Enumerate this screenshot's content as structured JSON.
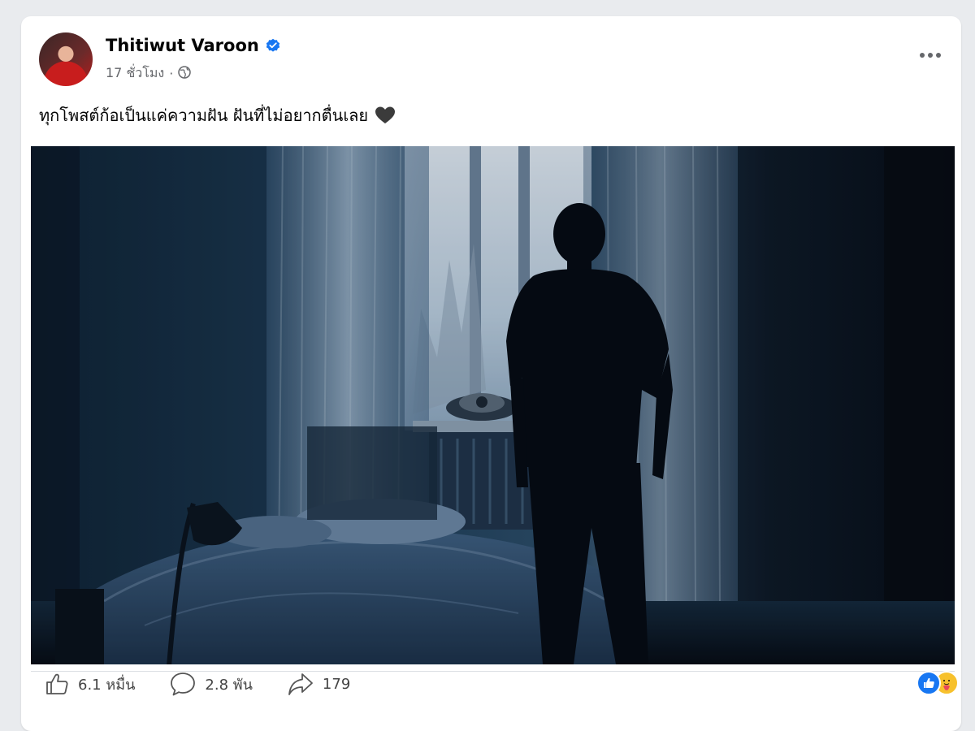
{
  "post": {
    "author_name": "Thitiwut Varoon",
    "time": "17 ชั่วโมง",
    "separator": "·",
    "text": "ทุกโพสต์ก้อเป็นแค่ความฝัน ฝันที่ไม่อยากตื่นเลย",
    "text_emoji": "black-heart",
    "image": "silhouette-man-at-window-dark-bedroom"
  },
  "stats": {
    "likes": "6.1 หมื่น",
    "comments": "2.8 พัน",
    "shares": "179"
  },
  "icons": {
    "verified": "verified-badge-icon",
    "privacy": "globe-icon",
    "more": "more-options-icon",
    "like": "thumbs-up-icon",
    "comment": "comment-bubble-icon",
    "share": "share-arrow-icon",
    "reactions": [
      "like-reaction-icon",
      "care-reaction-icon"
    ]
  },
  "colors": {
    "accent": "#1877f2",
    "text": "#050505",
    "muted": "#65676b",
    "card": "#ffffff"
  }
}
